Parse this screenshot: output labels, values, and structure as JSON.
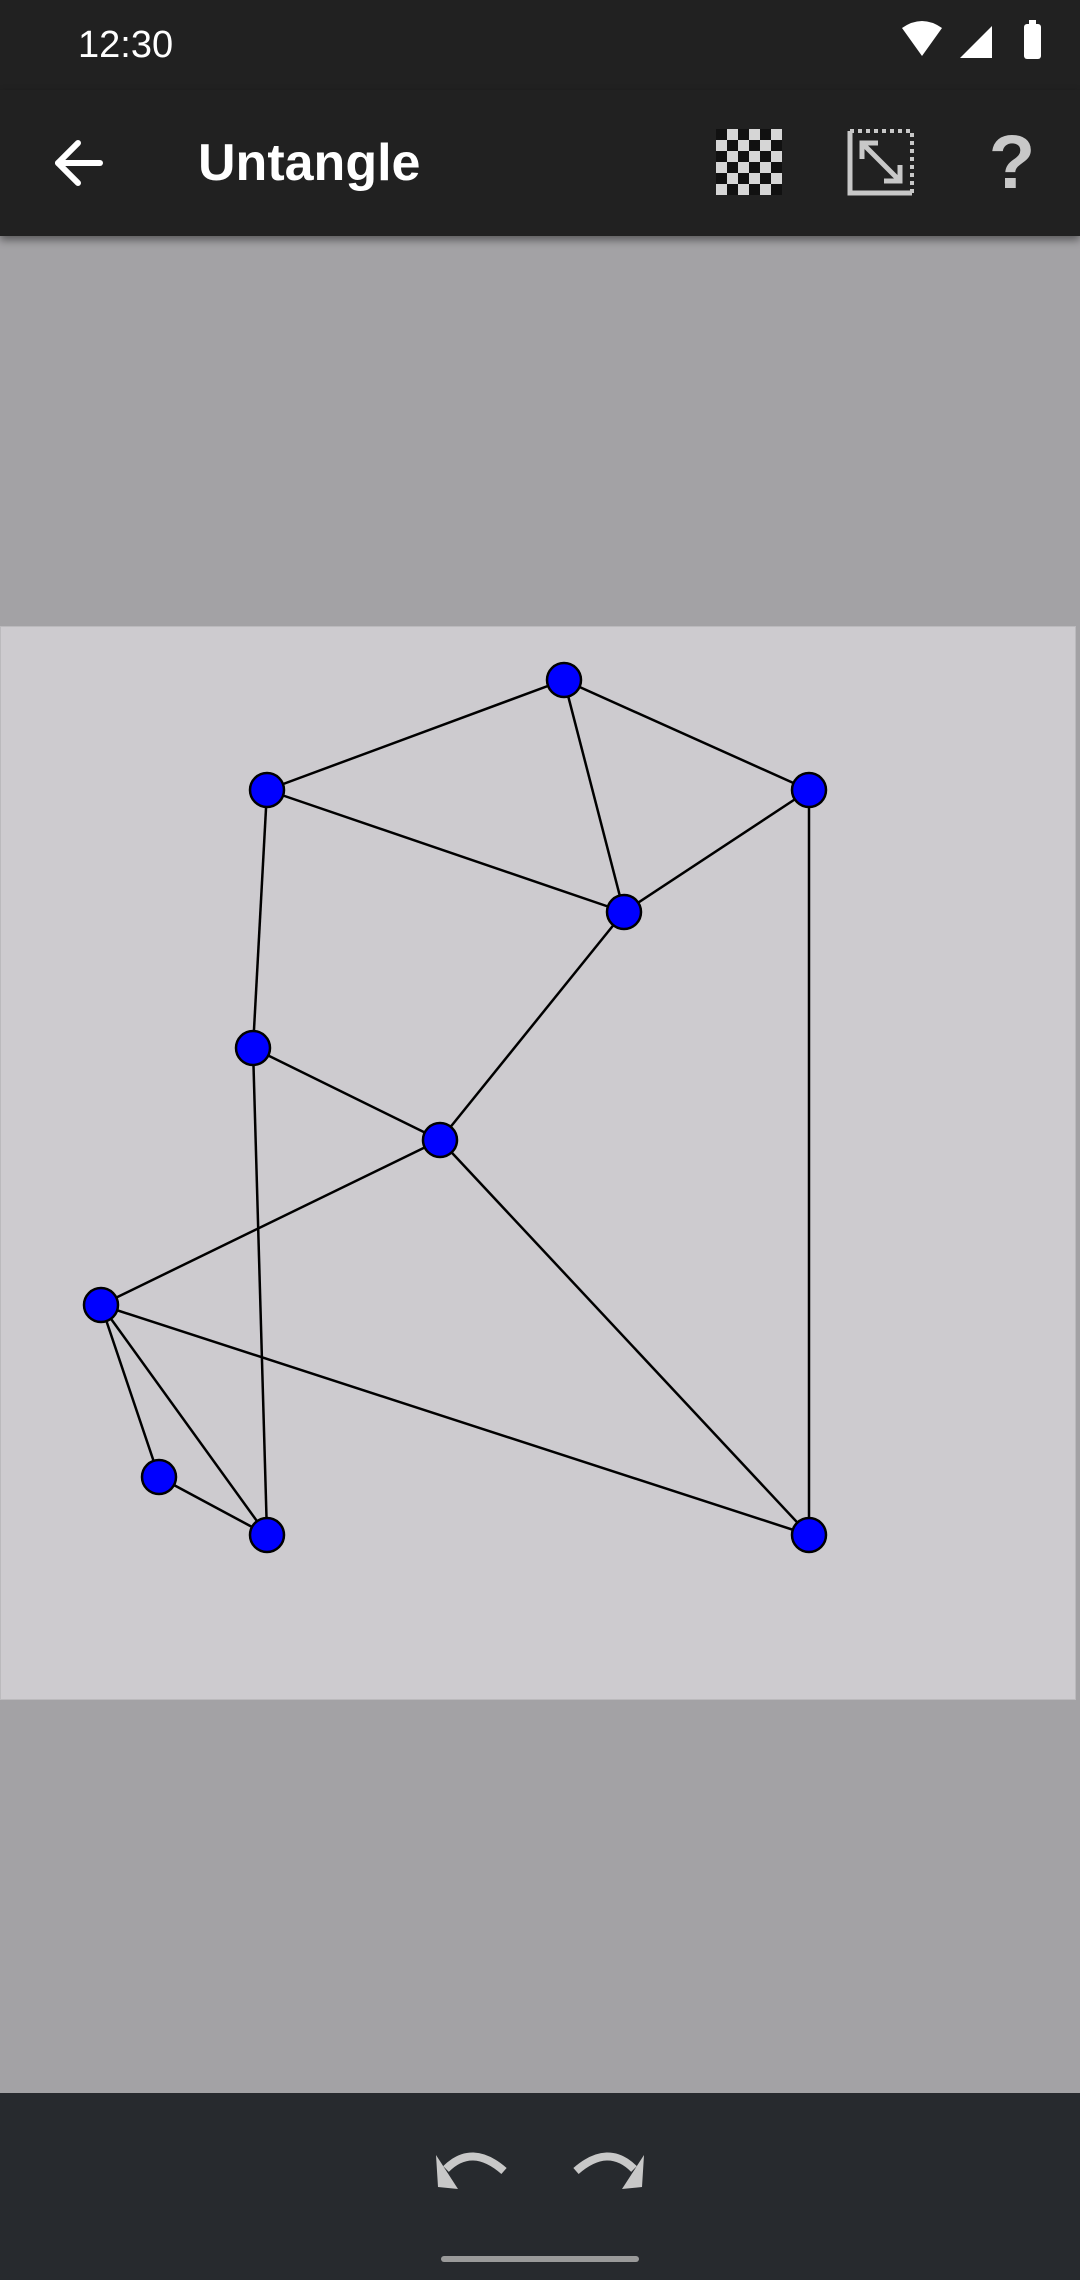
{
  "status_bar": {
    "time": "12:30"
  },
  "app_bar": {
    "title": "Untangle",
    "back_icon": "arrow-left-icon",
    "solve_icon": "checkerboard-icon",
    "resize_icon": "resize-diagonal-icon",
    "help_icon": "question-mark-icon",
    "help_glyph": "?"
  },
  "board": {
    "node_color": "#0000ff",
    "edge_color": "#000000",
    "nodes": [
      {
        "id": "n1"
      },
      {
        "id": "n2"
      },
      {
        "id": "n3"
      },
      {
        "id": "n4"
      },
      {
        "id": "n5"
      },
      {
        "id": "n6"
      },
      {
        "id": "n7"
      },
      {
        "id": "n8"
      },
      {
        "id": "n9"
      },
      {
        "id": "n10"
      },
      {
        "id": "n11"
      }
    ],
    "edges": [
      [
        "n1",
        "n2"
      ],
      [
        "n1",
        "n3"
      ],
      [
        "n1",
        "n4"
      ],
      [
        "n2",
        "n4"
      ],
      [
        "n3",
        "n4"
      ],
      [
        "n2",
        "n5"
      ],
      [
        "n5",
        "n6"
      ],
      [
        "n5",
        "n10"
      ],
      [
        "n4",
        "n6"
      ],
      [
        "n6",
        "n7"
      ],
      [
        "n6",
        "n11"
      ],
      [
        "n3",
        "n11"
      ],
      [
        "n7",
        "n8"
      ],
      [
        "n7",
        "n10"
      ],
      [
        "n7",
        "n11"
      ],
      [
        "n8",
        "n10"
      ]
    ]
  },
  "bottom_bar": {
    "undo_icon": "undo-icon",
    "redo_icon": "redo-icon"
  }
}
